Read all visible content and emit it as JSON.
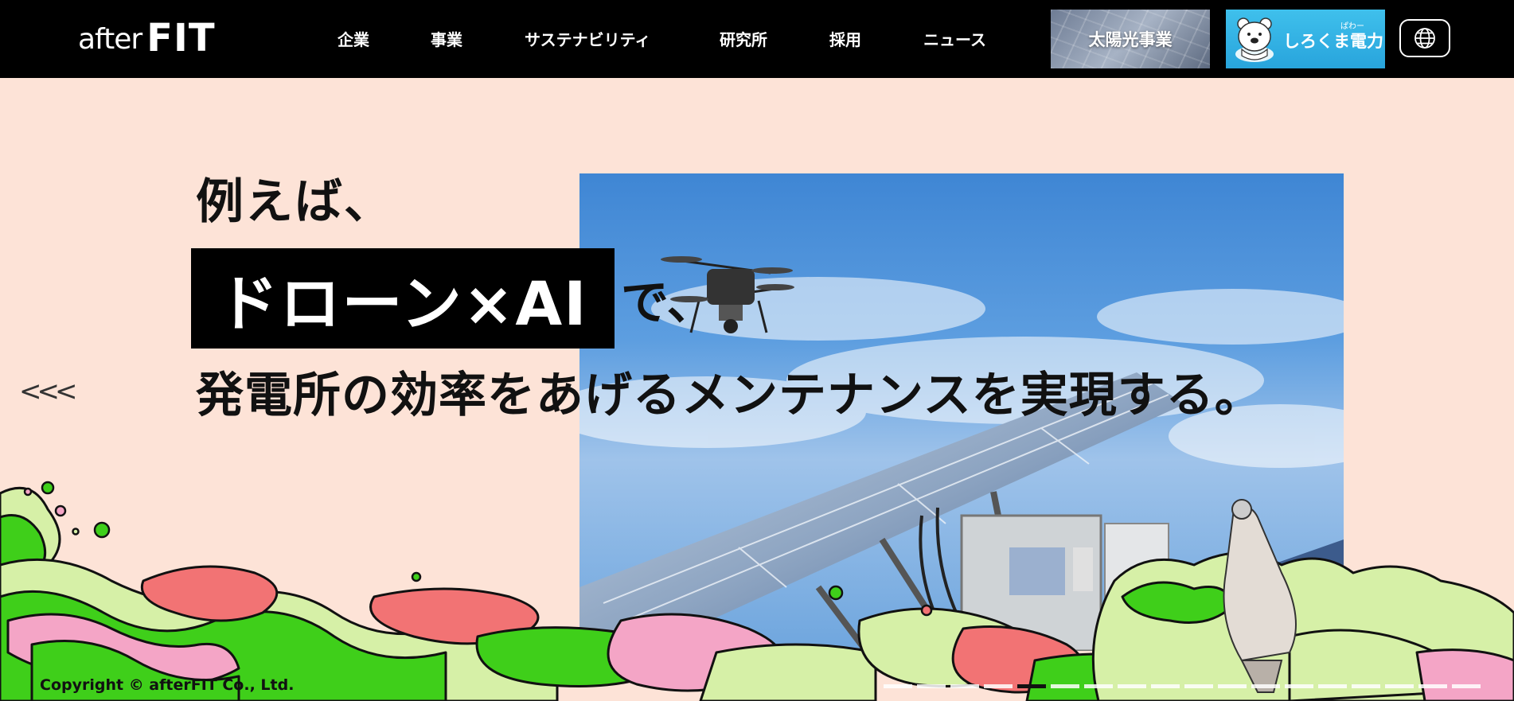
{
  "header": {
    "logo": {
      "after": "after",
      "fit": "FIT"
    },
    "nav": [
      {
        "label": "企業"
      },
      {
        "label": "事業"
      },
      {
        "label": "サステナビリティ"
      },
      {
        "label": "研究所"
      },
      {
        "label": "採用"
      },
      {
        "label": "ニュース"
      }
    ],
    "solar_button": {
      "label": "太陽光事業"
    },
    "power_button": {
      "label": "しろくま電力",
      "ruby": "ぱわー"
    },
    "language_icon": "globe-icon"
  },
  "hero": {
    "line1": "例えば、",
    "highlight": "ドローン×AI",
    "line2_rest": "で、",
    "line3": "発電所の効率をあげるメンテナンスを実現する。",
    "prev_arrow": "<<<"
  },
  "slider": {
    "count": 18,
    "active_index": 4
  },
  "footer": {
    "copyright": "Copyright © afterFIT Co., Ltd."
  },
  "colors": {
    "background": "#fde3d7",
    "header": "#000000",
    "power_blue": "#2aa6de",
    "blob_green": "#3fcf1a",
    "blob_light_green": "#d6f0a7",
    "blob_pink": "#f4a5c6",
    "blob_red": "#f27374"
  }
}
